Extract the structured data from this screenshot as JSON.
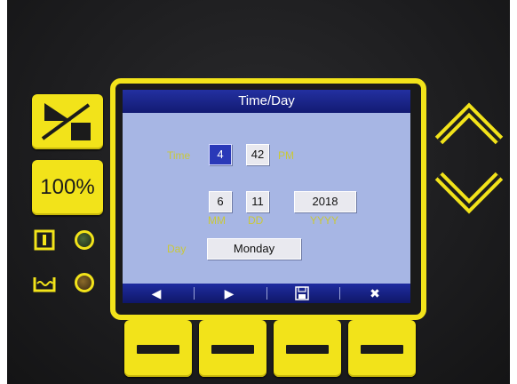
{
  "screen": {
    "title": "Time/Day",
    "time": {
      "label": "Time",
      "hour": "4",
      "minute": "42",
      "ampm": "PM"
    },
    "date": {
      "month": "6",
      "day": "11",
      "year": "2018",
      "month_label": "MM",
      "day_label": "DD",
      "year_label": "YYYY"
    },
    "weekday": {
      "label": "Day",
      "value": "Monday"
    },
    "softkeys": [
      {
        "name": "left-arrow",
        "glyph": "◀"
      },
      {
        "name": "right-arrow",
        "glyph": "▶"
      },
      {
        "name": "save",
        "glyph": ""
      },
      {
        "name": "cancel",
        "glyph": "✖"
      }
    ]
  },
  "panel": {
    "zoom_button_label": "100%",
    "accent_color": "#f2e31a",
    "screen_color": "#a7b6e4",
    "title_bar_color": "#1a2590"
  }
}
